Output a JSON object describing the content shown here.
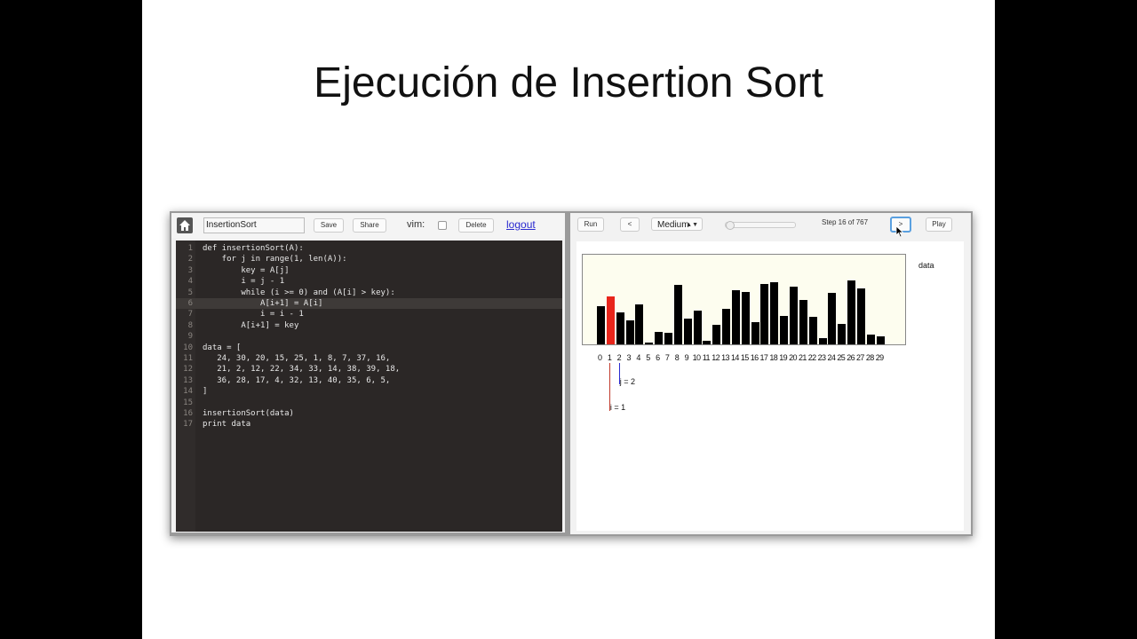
{
  "slide": {
    "title": "Ejecución de Insertion Sort"
  },
  "editor_toolbar": {
    "file_name": "InsertionSort",
    "save_label": "Save",
    "share_label": "Share",
    "vim_label": "vim:",
    "vim_enabled": false,
    "delete_label": "Delete",
    "logout_label": "logout"
  },
  "code": {
    "highlighted_line": 6,
    "lines": [
      "def insertionSort(A):",
      "    for j in range(1, len(A)):",
      "        key = A[j]",
      "        i = j - 1",
      "        while (i >= 0) and (A[i] > key):",
      "            A[i+1] = A[i]",
      "            i = i - 1",
      "        A[i+1] = key",
      "",
      "data = [",
      "   24, 30, 20, 15, 25, 1, 8, 7, 37, 16,",
      "   21, 2, 12, 22, 34, 33, 14, 38, 39, 18,",
      "   36, 28, 17, 4, 32, 13, 40, 35, 6, 5,",
      "]",
      "",
      "insertionSort(data)",
      "print data"
    ]
  },
  "viz_toolbar": {
    "run_label": "Run",
    "prev_label": "<",
    "speed_value": "Medium",
    "speed_arrows": "▲▼",
    "step_text": "Step 16 of 767",
    "next_label": ">",
    "play_label": "Play",
    "progress": 0.021
  },
  "chart_data": {
    "type": "bar",
    "variable": "data",
    "categories": [
      "0",
      "1",
      "2",
      "3",
      "4",
      "5",
      "6",
      "7",
      "8",
      "9",
      "10",
      "11",
      "12",
      "13",
      "14",
      "15",
      "16",
      "17",
      "18",
      "19",
      "20",
      "21",
      "22",
      "23",
      "24",
      "25",
      "26",
      "27",
      "28",
      "29"
    ],
    "values": [
      24,
      30,
      20,
      15,
      25,
      1,
      8,
      7,
      37,
      16,
      21,
      2,
      12,
      22,
      34,
      33,
      14,
      38,
      39,
      18,
      36,
      28,
      17,
      4,
      32,
      13,
      40,
      35,
      6,
      5
    ],
    "highlighted_index": 1,
    "highlight_color": "#e8251b",
    "bar_color": "#000000",
    "ylim": [
      0,
      40
    ],
    "pointers": [
      {
        "label": "j = 2",
        "index": 2,
        "color": "#2a2ad0"
      },
      {
        "label": "i = 1",
        "index": 1,
        "color": "#c0392b"
      }
    ]
  }
}
